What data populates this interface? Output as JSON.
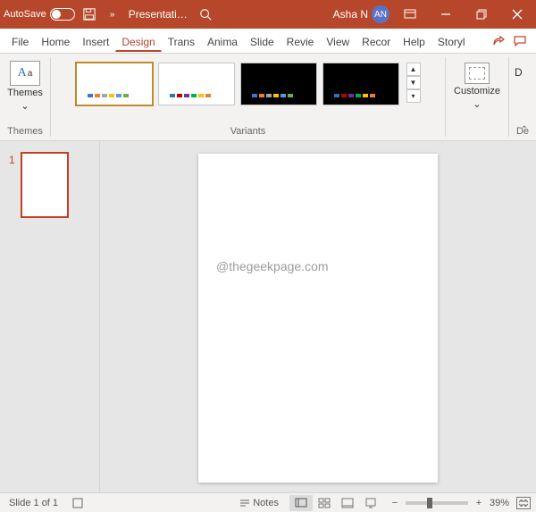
{
  "titlebar": {
    "autosave_label": "AutoSave",
    "autosave_state": "Off",
    "filename": "Presentati…",
    "user_name": "Asha N",
    "user_initials": "AN"
  },
  "menu": {
    "file": "File",
    "home": "Home",
    "insert": "Insert",
    "design": "Design",
    "trans": "Trans",
    "anima": "Anima",
    "slide": "Slide",
    "review": "Revie",
    "view": "View",
    "record": "Recor",
    "help": "Help",
    "storyl": "Storyl"
  },
  "ribbon": {
    "themes_label": "Themes",
    "themes_group": "Themes",
    "variants_group": "Variants",
    "customize_label": "Customize",
    "end_group": "De",
    "dropdown": "⌄"
  },
  "thumbs": {
    "slide1_num": "1"
  },
  "watermark": "@thegeekpage.com",
  "status": {
    "slide_info": "Slide 1 of 1",
    "notes_label": "Notes",
    "zoom_pct": "39%",
    "minus": "−",
    "plus": "+"
  }
}
